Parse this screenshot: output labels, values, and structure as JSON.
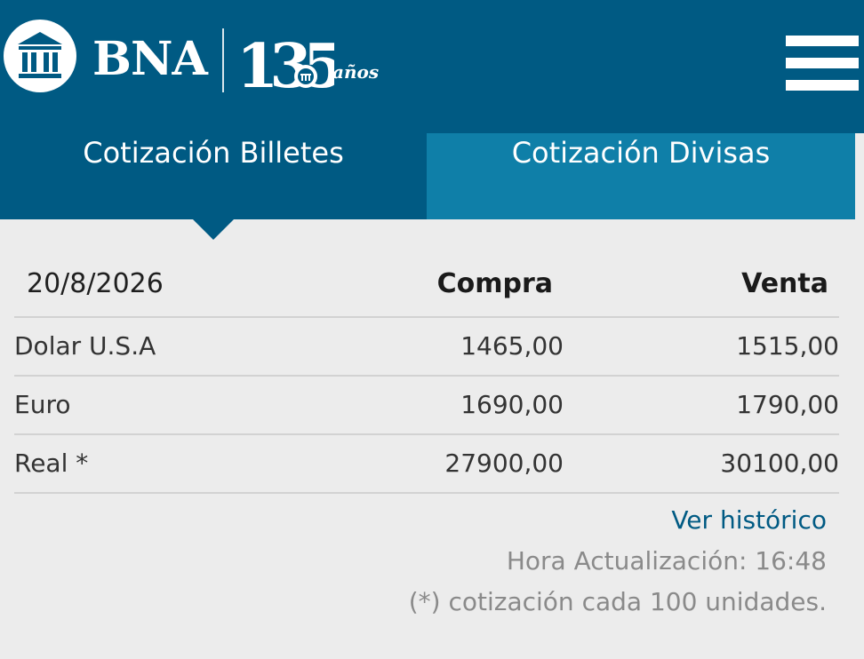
{
  "header": {
    "brand": "BNA",
    "anniversary_number": "135",
    "anniversary_suffix": "años",
    "logo_icon": "bank-building-icon",
    "menu_icon": "hamburger-menu-icon",
    "background_color": "#005a83"
  },
  "tabs": [
    {
      "label": "Cotización Billetes",
      "active": true,
      "color": "#005a83"
    },
    {
      "label": "Cotización Divisas",
      "active": false,
      "color": "#0f7fa8"
    }
  ],
  "table": {
    "date": "20/8/2026",
    "headers": {
      "compra": "Compra",
      "venta": "Venta"
    },
    "rows": [
      {
        "name": "Dolar U.S.A",
        "compra": "1465,00",
        "venta": "1515,00"
      },
      {
        "name": "Euro",
        "compra": "1690,00",
        "venta": "1790,00"
      },
      {
        "name": "Real *",
        "compra": "27900,00",
        "venta": "30100,00"
      }
    ]
  },
  "footer": {
    "historico_link": "Ver histórico",
    "hora_actualizacion": "Hora Actualización: 16:48",
    "note": "(*) cotización cada 100 unidades."
  }
}
